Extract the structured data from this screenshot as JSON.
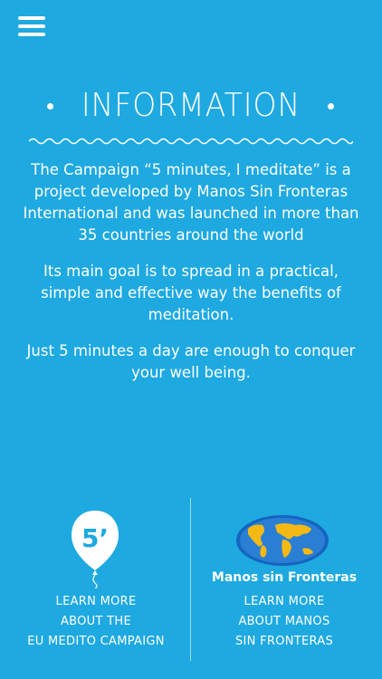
{
  "header": {
    "menu_icon": "hamburger-menu-icon"
  },
  "title": "INFORMATION",
  "paragraphs": [
    "The Campaign “5 minutes, I meditate” is a project developed by Manos Sin Fronteras International and was launched in more than 35 countries around the world",
    "Its main goal is to spread in a practical, simple and effective way the benefits of meditation.",
    "Just 5 minutes a day are enough to conquer your well being."
  ],
  "links": {
    "campaign": {
      "icon": "balloon-icon",
      "badge_text": "5’",
      "label": "LEARN MORE\nABOUT THE\nEU MEDITO CAMPAIGN"
    },
    "manos": {
      "icon": "globe-icon",
      "brand": "Manos sin Fronteras",
      "label": "LEARN MORE\nABOUT MANOS\nSIN FRONTERAS"
    }
  },
  "colors": {
    "background": "#1ea9e1",
    "text": "#ffffff",
    "globe_ocean": "#1565c0",
    "globe_land": "#f5b915"
  }
}
